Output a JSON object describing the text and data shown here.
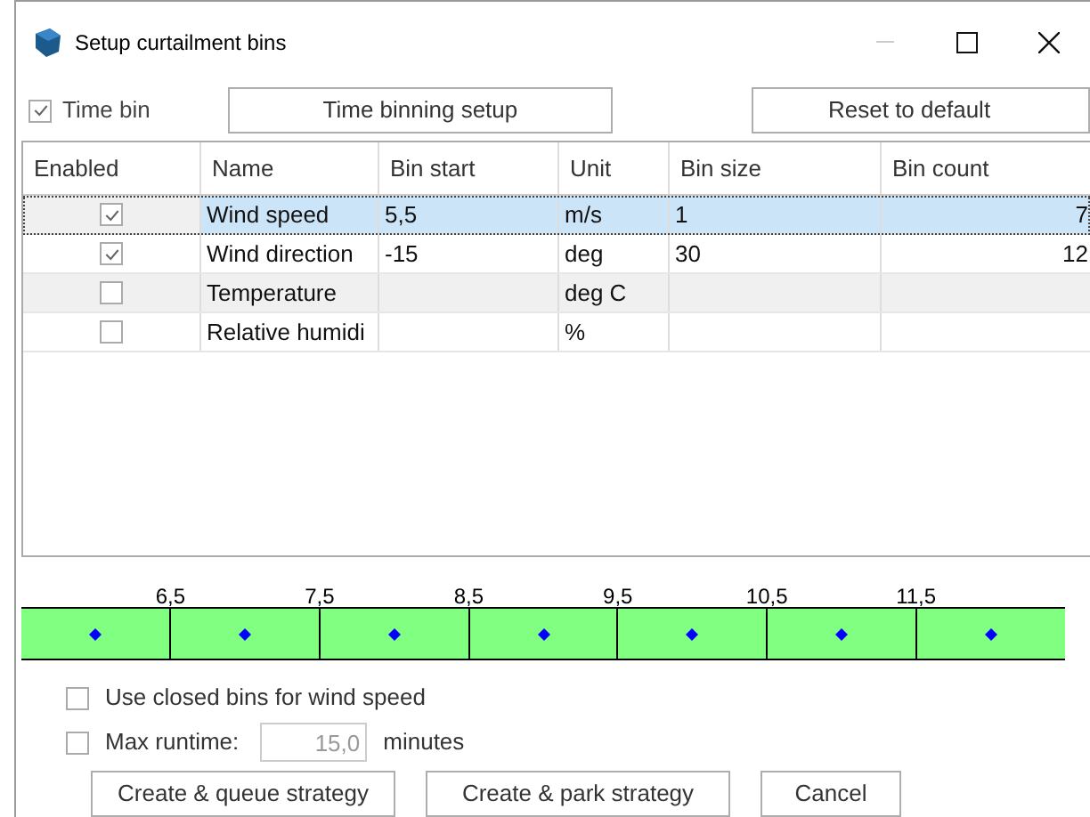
{
  "window": {
    "title": "Setup curtailment bins"
  },
  "time_bin": {
    "label": "Time bin",
    "checked": true
  },
  "buttons_top": [
    "Time binning setup",
    "Reset to default"
  ],
  "table": {
    "columns": [
      "Enabled",
      "Name",
      "Bin start",
      "Unit",
      "Bin size",
      "Bin count"
    ],
    "rows": [
      {
        "enabled": true,
        "name": "Wind speed",
        "bin_start": "5,5",
        "unit": "m/s",
        "bin_size": "1",
        "bin_count": "7",
        "selected": true
      },
      {
        "enabled": true,
        "name": "Wind direction",
        "bin_start": "-15",
        "unit": "deg",
        "bin_size": "30",
        "bin_count": "12",
        "selected": false
      },
      {
        "enabled": false,
        "name": "Temperature",
        "bin_start": "",
        "unit": "deg C",
        "bin_size": "",
        "bin_count": "",
        "selected": false
      },
      {
        "enabled": false,
        "name": "Relative humidi",
        "bin_start": "",
        "unit": "%",
        "bin_size": "",
        "bin_count": "",
        "selected": false
      }
    ]
  },
  "bin_strip": {
    "labels": [
      "6,5",
      "7,5",
      "8,5",
      "9,5",
      "10,5",
      "11,5"
    ]
  },
  "closed_bins": {
    "label": "Use closed bins for wind speed",
    "checked": false
  },
  "max_runtime": {
    "label": "Max runtime:",
    "checked": false,
    "value": "15,0",
    "unit": "minutes"
  },
  "buttons_bottom": [
    "Create & queue strategy",
    "Create & park strategy",
    "Cancel"
  ]
}
